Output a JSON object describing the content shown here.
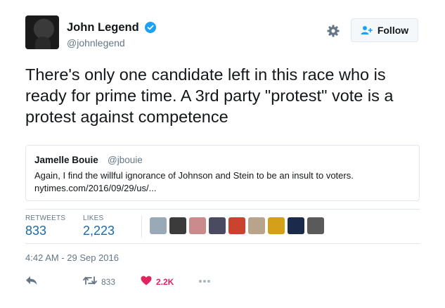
{
  "author": {
    "name": "John Legend",
    "handle": "@johnlegend"
  },
  "follow_label": "Follow",
  "tweet_text": "There's only one candidate left in this race who is ready for prime time. A 3rd party \"protest\" vote is a protest against competence",
  "quoted_tweet": {
    "name": "Jamelle Bouie",
    "handle": "@jbouie",
    "text_line1": "Again, I find the willful ignorance of Johnson and Stein to be an insult to voters.",
    "text_line2": "nytimes.com/2016/09/29/us/..."
  },
  "stats": {
    "retweets_label": "RETWEETS",
    "retweets_value": "833",
    "likes_label": "LIKES",
    "likes_value": "2,223"
  },
  "liker_avatar_colors": [
    "#9aa9b8",
    "#3b3b3b",
    "#c98b8b",
    "#4a4a60",
    "#c9432f",
    "#b8a48a",
    "#d4a017",
    "#1b2a4a",
    "#5a5a5a"
  ],
  "timestamp": "4:42 AM - 29 Sep 2016",
  "actions": {
    "retweet_count": "833",
    "like_count": "2.2K"
  },
  "colors": {
    "link": "#1b6aa5",
    "verified": "#1da1f2",
    "like": "#e0245e",
    "muted": "#657786"
  }
}
